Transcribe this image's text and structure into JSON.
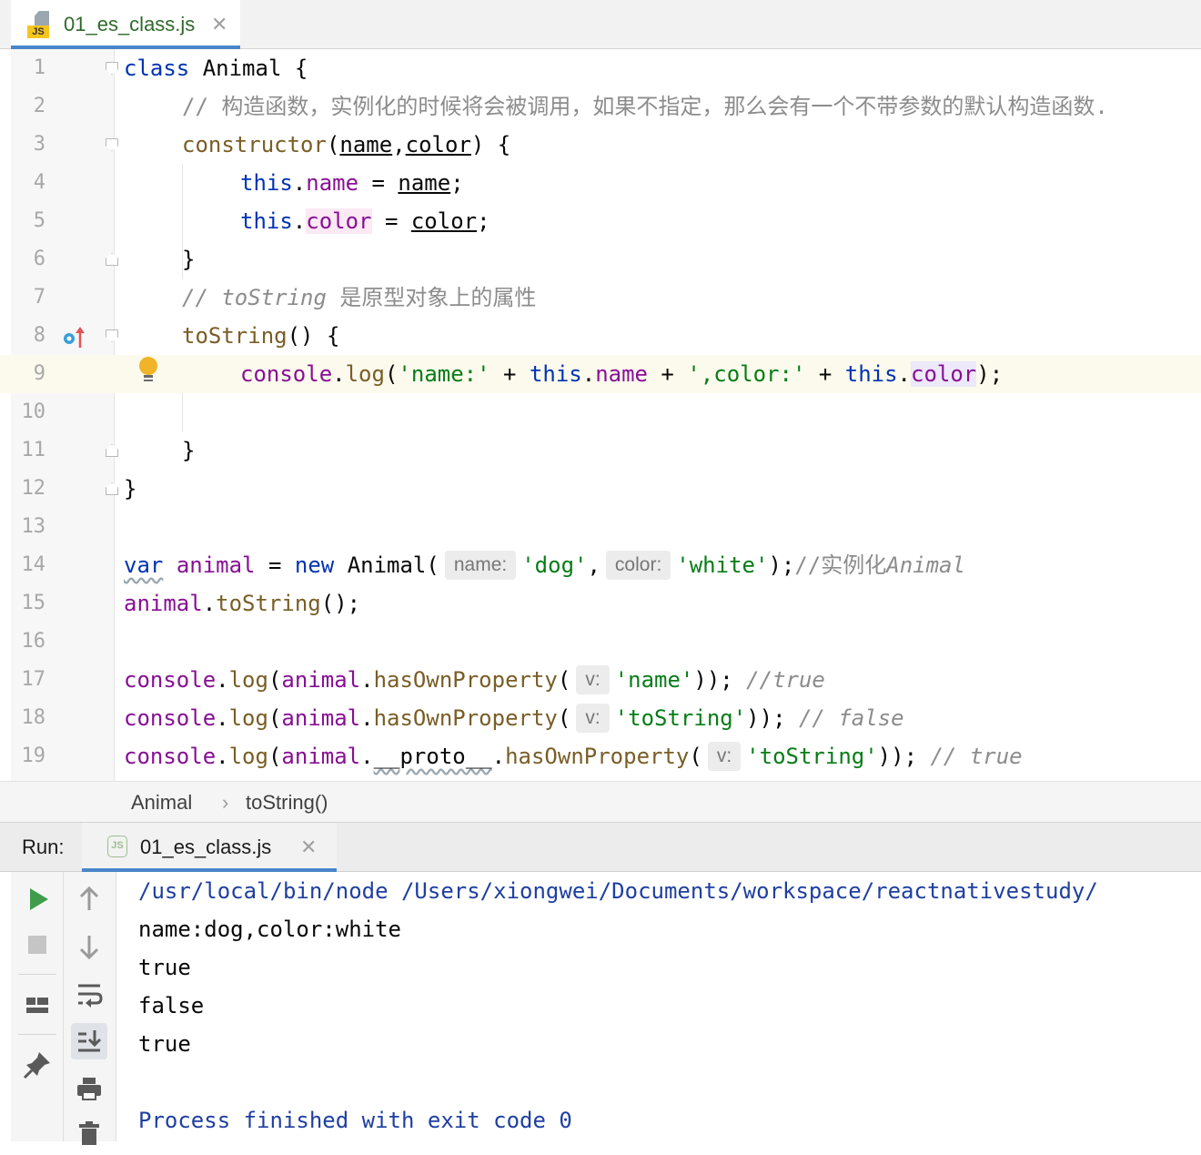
{
  "editor_tab": {
    "file_name": "01_es_class.js",
    "icon": "js-file-icon"
  },
  "code_lines": [
    {
      "n": "1"
    },
    {
      "n": "2"
    },
    {
      "n": "3"
    },
    {
      "n": "4"
    },
    {
      "n": "5"
    },
    {
      "n": "6"
    },
    {
      "n": "7"
    },
    {
      "n": "8"
    },
    {
      "n": "9"
    },
    {
      "n": "10"
    },
    {
      "n": "11"
    },
    {
      "n": "12"
    },
    {
      "n": "13"
    },
    {
      "n": "14"
    },
    {
      "n": "15"
    },
    {
      "n": "16"
    },
    {
      "n": "17"
    },
    {
      "n": "18"
    },
    {
      "n": "19"
    }
  ],
  "tokens": {
    "class_kw": "class",
    "class_name": "Animal",
    "open_brace": " {",
    "comment_constructor": "// 构造函数，实例化的时候将会被调用，如果不指定，那么会有一个不带参数的默认构造函数.",
    "constructor_fn": "constructor",
    "param_name": "name",
    "param_color": "color",
    "this_kw": "this",
    "prop_name": "name",
    "prop_color": "color",
    "comment_tostring": "// toString",
    "comment_tostring_zh": " 是原型对象上的属性",
    "tostring_fn": "toString",
    "console": "console",
    "log": "log",
    "str_name": "'name:'",
    "str_color": "',color:'",
    "var_kw": "var",
    "animal": "animal",
    "new_kw": "new",
    "hint_name": "name:",
    "hint_color": "color:",
    "hint_v": "v:",
    "str_dog": "'dog'",
    "str_white": "'white'",
    "comment_instantiate": "//实例化",
    "comment_instantiate_cls": "Animal",
    "hasown": "hasOwnProperty",
    "str_name2": "'name'",
    "str_tostring": "'toString'",
    "comment_true": "//true",
    "comment_false": "// false",
    "comment_true2": "// true",
    "proto": "__proto__"
  },
  "breadcrumb": {
    "items": [
      "Animal",
      "toString()"
    ],
    "separator": "›"
  },
  "run_panel": {
    "label": "Run:",
    "tab_name": "01_es_class.js",
    "tab_icon": "nodejs-icon",
    "console_lines": [
      "/usr/local/bin/node /Users/xiongwei/Documents/workspace/reactnativestudy/",
      "name:dog,color:white",
      "true",
      "false",
      "true",
      "",
      "Process finished with exit code 0"
    ]
  },
  "colors": {
    "keyword": "#0033b3",
    "function": "#795e26",
    "string": "#067d17",
    "property": "#871094",
    "comment": "#8c8c8c",
    "tab_accent": "#4a86c8",
    "caret_row": "#fcfaed"
  }
}
